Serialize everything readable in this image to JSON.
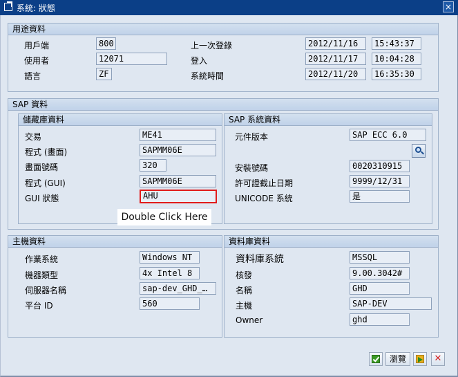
{
  "window": {
    "title": "系統: 狀態",
    "close_glyph": "×"
  },
  "usage": {
    "heading": "用途資料",
    "client_label": "用戶端",
    "client_value": "800",
    "user_label": "使用者",
    "user_value": "12071",
    "language_label": "語言",
    "language_value": "ZF",
    "prev_login_label": "上一次登錄",
    "prev_login_date": "2012/11/16",
    "prev_login_time": "15:43:37",
    "login_label": "登入",
    "login_date": "2012/11/17",
    "login_time": "10:04:28",
    "system_time_label": "系統時間",
    "system_time_date": "2012/11/20",
    "system_time_time": "16:35:30"
  },
  "sap": {
    "heading": "SAP 資料",
    "repository": {
      "heading": "儲藏庫資料",
      "transaction_label": "交易",
      "transaction_value": "ME41",
      "program_screen_label": "程式 (畫面)",
      "program_screen_value": "SAPMM06E",
      "screen_number_label": "畫面號碼",
      "screen_number_value": "320",
      "program_gui_label": "程式 (GUI)",
      "program_gui_value": "SAPMM06E",
      "gui_status_label": "GUI 狀態",
      "gui_status_value": "AHU"
    },
    "system": {
      "heading": "SAP 系統資料",
      "component_version_label": "元件版本",
      "component_version_value": "SAP ECC 6.0",
      "installation_number_label": "安裝號碼",
      "installation_number_value": "0020310915",
      "license_expiry_label": "許可證截止日期",
      "license_expiry_value": "9999/12/31",
      "unicode_label": "UNICODE 系統",
      "unicode_value": "是"
    },
    "tooltip": "Double Click Here"
  },
  "host": {
    "heading": "主機資料",
    "os_label": "作業系統",
    "os_value": "Windows NT",
    "machine_type_label": "機器類型",
    "machine_type_value": "4x Intel 8",
    "server_name_label": "伺服器名稱",
    "server_name_value": "sap-dev_GHD_…",
    "platform_id_label": "平台 ID",
    "platform_id_value": "560"
  },
  "database": {
    "heading": "資料庫資料",
    "db_system_label": "資料庫系統",
    "db_system_value": "MSSQL",
    "release_label": "核發",
    "release_value": "9.00.3042#",
    "name_label": "名稱",
    "name_value": "GHD",
    "host_label": "主機",
    "host_value": "SAP-DEV",
    "owner_label": "Owner",
    "owner_value": "ghd"
  },
  "footer": {
    "browse_label": "瀏覽",
    "close_glyph": "✕"
  }
}
